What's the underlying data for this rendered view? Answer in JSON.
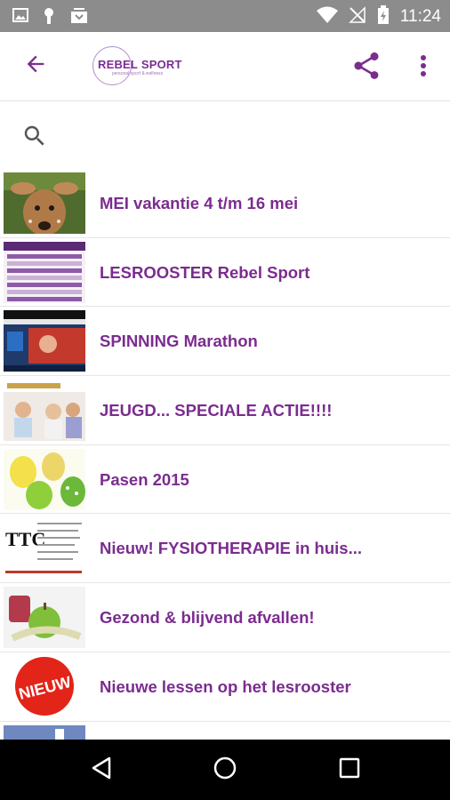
{
  "status_bar": {
    "time": "11:24",
    "icons": [
      "image-icon",
      "android-icon",
      "inbox-icon",
      "wifi-icon",
      "no-signal-icon",
      "battery-charging-icon"
    ]
  },
  "app_bar": {
    "logo": {
      "name": "REBEL SPORT",
      "word1": "REBEL",
      "word2": "SPORT",
      "tagline": "personal sport & wellness"
    },
    "back_icon": "arrow-back-icon",
    "share_icon": "share-icon",
    "more_icon": "more-vert-icon"
  },
  "search": {
    "placeholder": "",
    "value": ""
  },
  "colors": {
    "accent": "#7b2c8f",
    "status_bar": "#8c8c8c",
    "nav_bar": "#000000"
  },
  "list": {
    "items": [
      {
        "title": "MEI vakantie 4 t/m 16 mei",
        "thumb": "fawn"
      },
      {
        "title": "LESROOSTER Rebel Sport",
        "thumb": "schedule"
      },
      {
        "title": "SPINNING Marathon",
        "thumb": "spinning"
      },
      {
        "title": "JEUGD... SPECIALE ACTIE!!!!",
        "thumb": "youth"
      },
      {
        "title": "Pasen 2015",
        "thumb": "easter-eggs"
      },
      {
        "title": "Nieuw! FYSIOTHERAPIE in huis...",
        "thumb": "ttc"
      },
      {
        "title": "Gezond & blijvend afvallen!",
        "thumb": "apple-measure"
      },
      {
        "title": "Nieuwe lessen op het lesrooster",
        "thumb": "nieuw-badge"
      },
      {
        "title": "",
        "thumb": "facebook"
      }
    ]
  },
  "nav_bar": {
    "icons": [
      "nav-back-icon",
      "nav-home-icon",
      "nav-recents-icon"
    ]
  }
}
